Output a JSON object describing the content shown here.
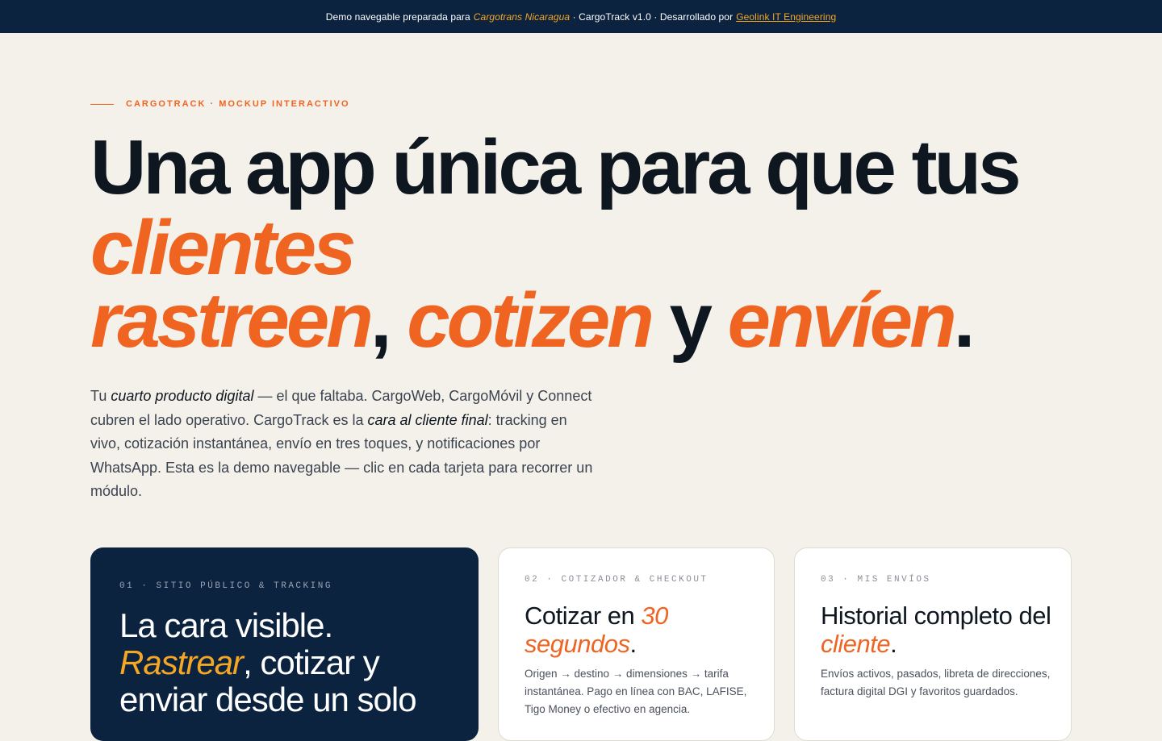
{
  "banner": {
    "prefix": "Demo navegable preparada para",
    "client": "Cargotrans Nicaragua",
    "middle": " · CargoTrack v1.0 · Desarrollado por",
    "developer": "Geolink IT Engineering"
  },
  "hero": {
    "eyebrow": "CARGOTRACK · MOCKUP INTERACTIVO",
    "headline": {
      "line1": "Una app única para que tus",
      "word_clientes": "clientes",
      "word_rastreen": "rastreen",
      "comma": ",",
      "word_cotizen": "cotizen",
      "conj": "y",
      "word_envien": "envíen",
      "period": "."
    },
    "intro": {
      "t1": "Tu ",
      "e1": "cuarto producto digital",
      "t2": " — el que faltaba. CargoWeb, CargoMóvil y Connect cubren el lado operativo. CargoTrack es la ",
      "e2": "cara al cliente final",
      "t3": ": tracking en vivo, cotización instantánea, envío en tres toques, y notificaciones por WhatsApp. Esta es la demo navegable — clic en cada tarjeta para recorrer un módulo."
    }
  },
  "cards": [
    {
      "kicker": "01 · SITIO PÚBLICO & TRACKING",
      "title_a": "La cara visible.",
      "title_accent": "Rastrear",
      "title_b": ", cotizar y enviar desde un solo"
    },
    {
      "kicker": "02 · COTIZADOR & CHECKOUT",
      "title_a": "Cotizar en ",
      "title_accent": "30 segundos",
      "title_b": ".",
      "desc": "Origen → destino → dimensiones → tarifa instantánea. Pago en línea con BAC, LAFISE, Tigo Money o efectivo en agencia."
    },
    {
      "kicker": "03 · MIS ENVÍOS",
      "title_a": "Historial completo del ",
      "title_accent": "cliente",
      "title_b": ".",
      "desc": "Envíos activos, pasados, libreta de direcciones, factura digital DGI y favoritos guardados."
    }
  ],
  "colors": {
    "navy": "#0c2340",
    "orange": "#f06422",
    "amber": "#f5a623",
    "cream": "#f4f1ea"
  }
}
